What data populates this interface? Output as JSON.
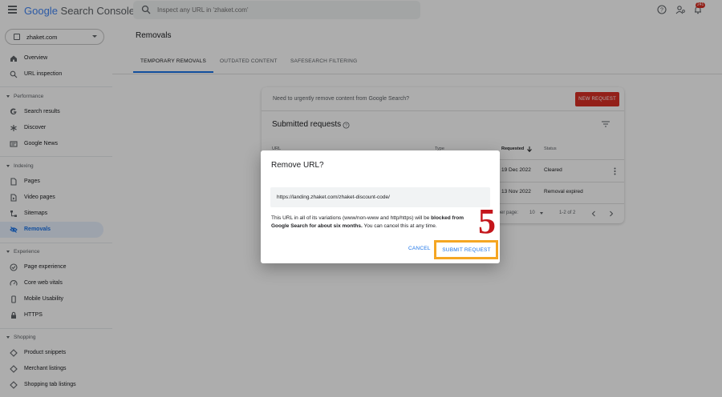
{
  "header": {
    "logo_google": "Google",
    "logo_product": " Search Console",
    "search_placeholder": "Inspect any URL in 'zhaket.com'",
    "notification_count": "241",
    "icons": [
      "menu-icon",
      "search-icon",
      "help-icon",
      "account-settings-icon",
      "bell-icon"
    ]
  },
  "sidebar": {
    "property": "zhaket.com",
    "top_items": [
      {
        "label": "Overview",
        "icon": "home-icon"
      },
      {
        "label": "URL inspection",
        "icon": "search-icon"
      }
    ],
    "sections": [
      {
        "title": "Performance",
        "items": [
          {
            "label": "Search results",
            "icon": "google-g-icon"
          },
          {
            "label": "Discover",
            "icon": "asterisk-icon"
          },
          {
            "label": "Google News",
            "icon": "news-icon"
          }
        ]
      },
      {
        "title": "Indexing",
        "items": [
          {
            "label": "Pages",
            "icon": "pages-icon"
          },
          {
            "label": "Video pages",
            "icon": "video-pages-icon"
          },
          {
            "label": "Sitemaps",
            "icon": "sitemap-icon"
          },
          {
            "label": "Removals",
            "icon": "eye-off-icon",
            "active": true
          }
        ]
      },
      {
        "title": "Experience",
        "items": [
          {
            "label": "Page experience",
            "icon": "page-experience-icon"
          },
          {
            "label": "Core web vitals",
            "icon": "gauge-icon"
          },
          {
            "label": "Mobile Usability",
            "icon": "mobile-icon"
          },
          {
            "label": "HTTPS",
            "icon": "lock-icon"
          }
        ]
      },
      {
        "title": "Shopping",
        "items": [
          {
            "label": "Product snippets",
            "icon": "diamond-icon"
          },
          {
            "label": "Merchant listings",
            "icon": "diamond-icon"
          },
          {
            "label": "Shopping tab listings",
            "icon": "diamond-icon"
          }
        ]
      }
    ]
  },
  "main": {
    "title": "Removals",
    "tabs": [
      "TEMPORARY REMOVALS",
      "OUTDATED CONTENT",
      "SAFESEARCH FILTERING"
    ],
    "banner_text": "Need to urgently remove content from Google Search?",
    "new_request": "NEW REQUEST",
    "submitted_title": "Submitted requests",
    "columns": [
      "URL",
      "Type",
      "Requested",
      "Status"
    ],
    "rows": [
      {
        "requested": "19 Dec 2022",
        "status": "Cleared"
      },
      {
        "requested": "13 Nov 2022",
        "status": "Removal expired"
      }
    ],
    "rows_per_page_label": "Rows per page:",
    "rows_per_page": "10",
    "pagination": "1-2 of 2"
  },
  "dialog": {
    "title": "Remove URL?",
    "url_value": "https://landing.zhaket.com/zhaket-discount-code/",
    "body_part1": "This URL in all of its variations (www/non-www and http/https) will be ",
    "body_bold": "blocked from Google Search for about six months.",
    "body_part2": " You can cancel this at any time.",
    "cancel": "CANCEL",
    "submit": "SUBMIT REQUEST"
  },
  "annotation": {
    "step": "5",
    "highlight_color": "#f5a623",
    "step_color": "#c4161c"
  },
  "colors": {
    "accent": "#1a73e8",
    "danger": "#d93025"
  }
}
